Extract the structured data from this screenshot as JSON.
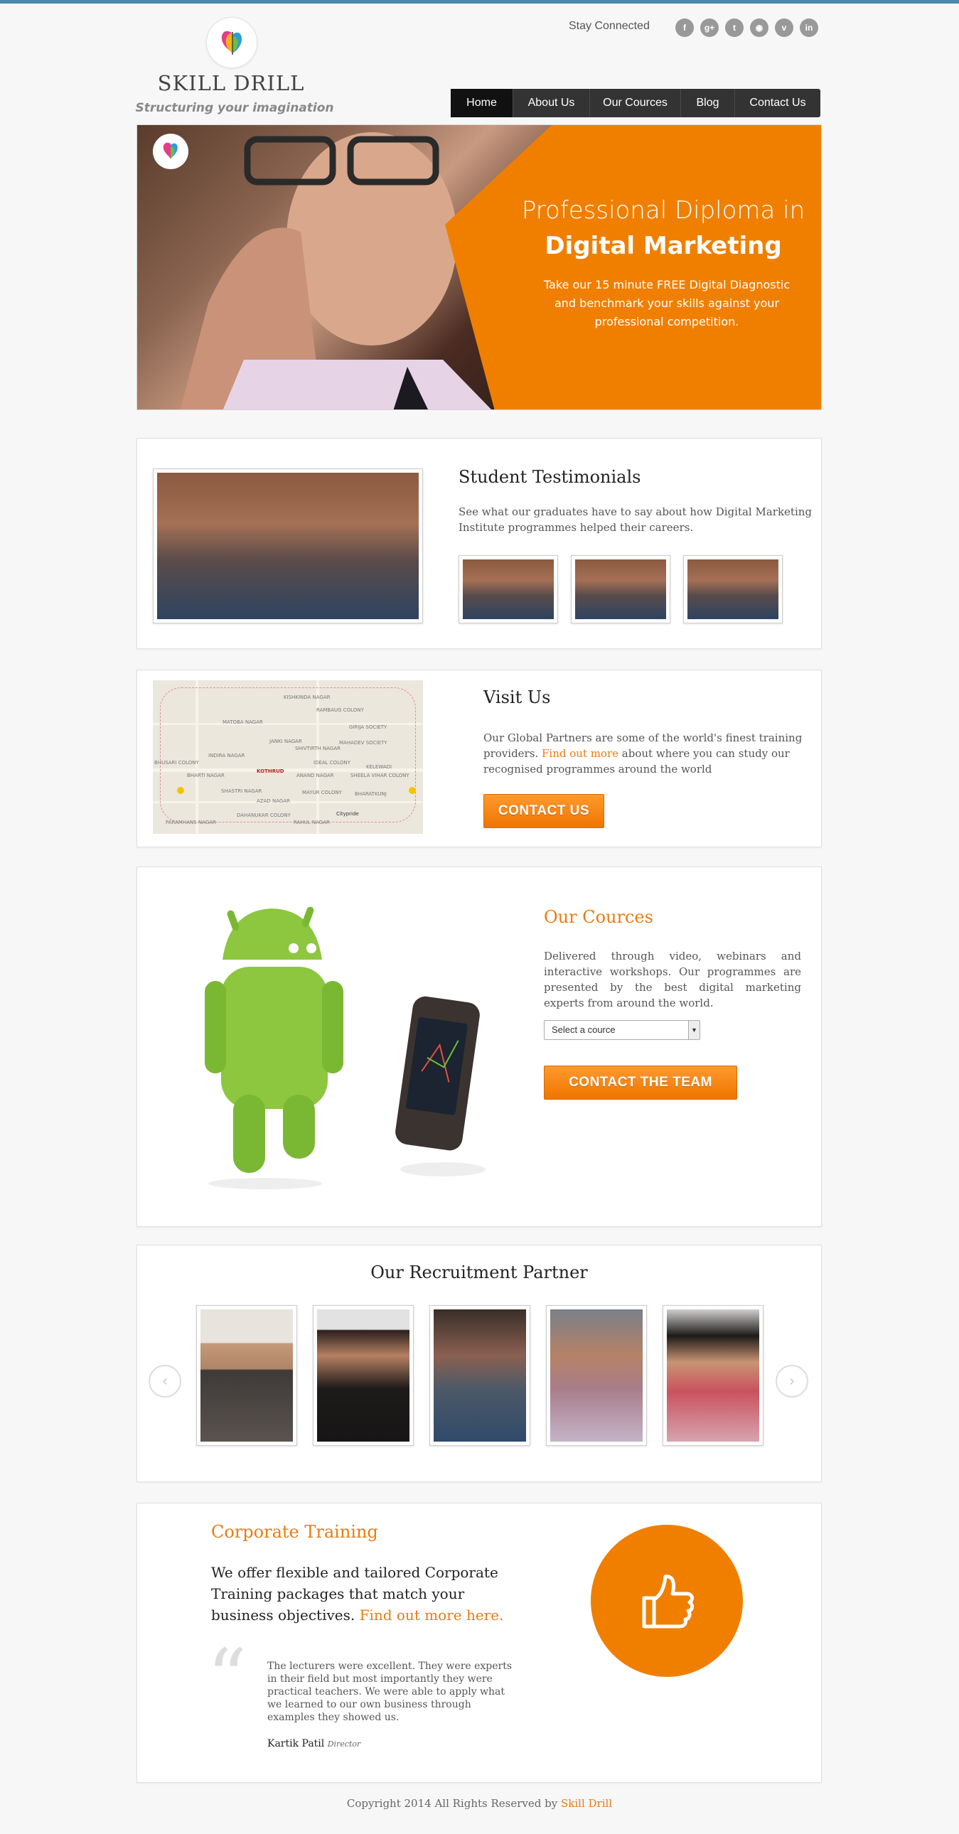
{
  "header": {
    "brand_name": "SKILL DRILL",
    "tagline": "Structuring your imagination",
    "stay_connected": "Stay Connected",
    "social_icons": [
      "facebook-icon",
      "google-plus-icon",
      "twitter-icon",
      "rss-icon",
      "vimeo-icon",
      "linkedin-icon"
    ]
  },
  "nav": {
    "items": [
      "Home",
      "About Us",
      "Our Cources",
      "Blog",
      "Contact Us"
    ],
    "active": "Home"
  },
  "hero": {
    "title_line1": "Professional Diploma in",
    "title_line2": "Digital Marketing",
    "subtitle": "Take our 15 minute FREE Digital Diagnostic and benchmark your skills against your professional competition."
  },
  "testimonials": {
    "heading": "Student Testimonials",
    "text": "See what our graduates have to say about how Digital Marketing Institute programmes helped their careers."
  },
  "visit": {
    "heading": "Visit Us",
    "text_before": "Our Global Partners are some of the world's finest training providers.",
    "link": "Find out more",
    "text_after": "about where you can study our recognised programmes around the world",
    "button": "CONTACT US",
    "map_labels": [
      "KISHKINDA NAGAR",
      "RAMBAUG COLONY",
      "MATOBA NAGAR",
      "GIRIJA SOCIETY",
      "JANKI NAGAR",
      "SHIVTIRTH NAGAR",
      "MAHADEV SOCIETY",
      "INDIRA NAGAR",
      "IDEAL COLONY",
      "KELEWADI",
      "BHUSARI COLONY",
      "KOTHRUD",
      "ANAND NAGAR",
      "SHEELA VIHAR COLONY",
      "BHARTI NAGAR",
      "PARAMHANS NAGAR",
      "SHASTRI NAGAR",
      "MAYUR COLONY",
      "BHARATKUNJ",
      "AZAD NAGAR",
      "DAHANUKAR COLONY",
      "Citypride",
      "RAHUL NAGAR"
    ]
  },
  "courses": {
    "heading": "Our Cources",
    "text": "Delivered through video, webinars and interactive workshops. Our programmes are presented by the best digital marketing experts from around the world.",
    "select_value": "Select a cource",
    "button": "CONTACT THE TEAM"
  },
  "partners": {
    "heading": "Our Recruitment Partner",
    "prev": "‹",
    "next": "›"
  },
  "corporate": {
    "heading": "Corporate Training",
    "lead": "We offer flexible and tailored Corporate Training packages that match your business objectives.",
    "lead_link": "Find out more here.",
    "quote": "The lecturers were excellent. They were experts in their field but most importantly they were practical teachers. We were able to apply what we learned to our own business through examples they showed us.",
    "author": "Kartik Patil",
    "role": "Director"
  },
  "footer": {
    "text": "Copyright 2014 All Rights Reserved by",
    "brand": "Skill Drill"
  },
  "colors": {
    "accent": "#f07f00",
    "nav_bg": "#333333",
    "top_bar": "#4a87a8"
  }
}
